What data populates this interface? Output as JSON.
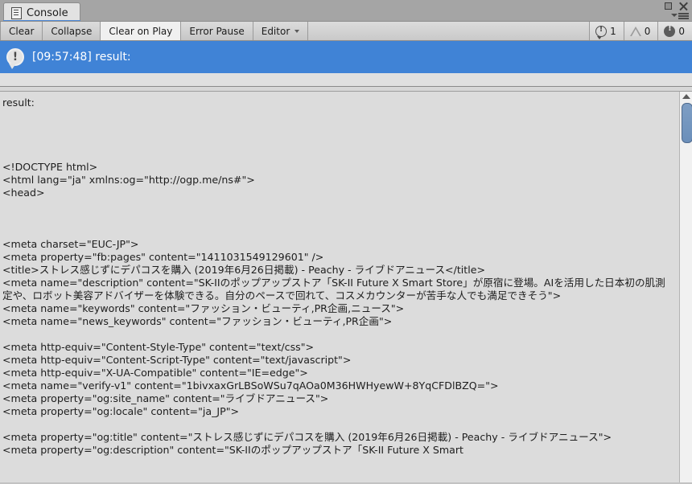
{
  "window": {
    "tab_label": "Console",
    "tab_icon": "document-icon",
    "maximize_icon": "maximize-icon",
    "close_icon": "close-icon",
    "menu_icon": "hamburger-menu-icon"
  },
  "toolbar": {
    "clear_label": "Clear",
    "collapse_label": "Collapse",
    "clear_on_play_label": "Clear on Play",
    "error_pause_label": "Error Pause",
    "editor_label": "Editor",
    "editor_caret_icon": "chevron-down-icon",
    "counters": {
      "info_icon": "info-message-icon",
      "info_count": "1",
      "warning_icon": "warning-message-icon",
      "warning_count": "0",
      "error_icon": "error-message-icon",
      "error_count": "0"
    }
  },
  "log_list": {
    "selected_entry": {
      "icon": "info-message-icon",
      "text": "[09:57:48] result:"
    }
  },
  "detail": {
    "content": "result:\n\n\n\n\n<!DOCTYPE html>\n<html lang=\"ja\" xmlns:og=\"http://ogp.me/ns#\">\n<head>\n\n\n\n<meta charset=\"EUC-JP\">\n<meta property=\"fb:pages\" content=\"1411031549129601\" />\n<title>ストレス感じずにデパコスを購入 (2019年6月26日掲載) - Peachy - ライブドアニュース</title>\n<meta name=\"description\" content=\"SK-IIのポップアップストア「SK-II Future X Smart Store」が原宿に登場。AIを活用した日本初の肌測定や、ロボット美容アドバイザーを体験できる。自分のペースで回れて、コスメカウンターが苦手な人でも満足できそう\">\n<meta name=\"keywords\" content=\"ファッション・ビューティ,PR企画,ニュース\">\n<meta name=\"news_keywords\" content=\"ファッション・ビューティ,PR企画\">\n\n<meta http-equiv=\"Content-Style-Type\" content=\"text/css\">\n<meta http-equiv=\"Content-Script-Type\" content=\"text/javascript\">\n<meta http-equiv=\"X-UA-Compatible\" content=\"IE=edge\">\n<meta name=\"verify-v1\" content=\"1bivxaxGrLBSoWSu7qAOa0M36HWHyewW+8YqCFDlBZQ=\">\n<meta property=\"og:site_name\" content=\"ライブドアニュース\">\n<meta property=\"og:locale\" content=\"ja_JP\">\n\n<meta property=\"og:title\" content=\"ストレス感じずにデパコスを購入 (2019年6月26日掲載) - Peachy - ライブドアニュース\">\n<meta property=\"og:description\" content=\"SK-IIのポップアップストア「SK-II Future X Smart"
  },
  "scrollbar": {
    "up_arrow_icon": "scroll-up-arrow-icon",
    "thumb": "scrollbar-thumb"
  },
  "colors": {
    "selection_blue": "#4083d6",
    "tab_accent": "#4f8ad8",
    "panel_bg": "#dcdcdc",
    "toolbar_bg": "#c9c9c9"
  }
}
